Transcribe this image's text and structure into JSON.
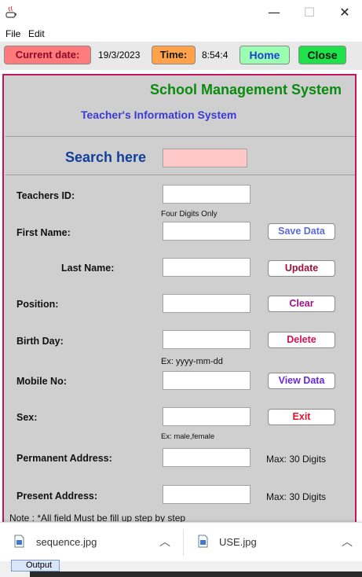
{
  "menu": {
    "file": "File",
    "edit": "Edit"
  },
  "window": {
    "minimize": "—",
    "maximize": "☐",
    "close": "✕"
  },
  "toolbar": {
    "current_date_label": "Current date:",
    "current_date_value": "19/3/2023",
    "time_label": "Time:",
    "time_value": "8:54:4",
    "home_label": "Home",
    "close_label": "Close"
  },
  "header": {
    "title": "School Management System",
    "subtitle": "Teacher's Information System"
  },
  "search": {
    "label": "Search here",
    "value": ""
  },
  "form": {
    "teacher_id_label": "Teachers ID:",
    "teacher_id_hint": "Four Digits Only",
    "first_name_label": "First Name:",
    "last_name_label": "Last Name:",
    "position_label": "Position:",
    "birth_day_label": "Birth Day:",
    "birth_day_hint": "Ex: yyyy-mm-dd",
    "mobile_label": "Mobile No:",
    "sex_label": "Sex:",
    "sex_hint": "Ex: male,female",
    "permanent_address_label": "Permanent Address:",
    "permanent_address_max": "Max: 30 Digits",
    "present_address_label": "Present Address:",
    "present_address_max": "Max: 30 Digits",
    "note": "Note : *All field Must be fill up step by step"
  },
  "buttons": {
    "save": "Save Data",
    "update": "Update",
    "clear": "Clear",
    "delete": "Delete",
    "view": "View Data",
    "exit": "Exit"
  },
  "downloads": [
    {
      "name": "sequence.jpg"
    },
    {
      "name": "USE.jpg"
    }
  ],
  "taskbar": {
    "output_label": "Output"
  },
  "colors": {
    "panel_border": "#c4145f",
    "title_green": "#0b8a10",
    "subtitle_blue": "#3a3ad6",
    "search_blue": "#123f9a",
    "search_field": "#ffc8c8"
  }
}
